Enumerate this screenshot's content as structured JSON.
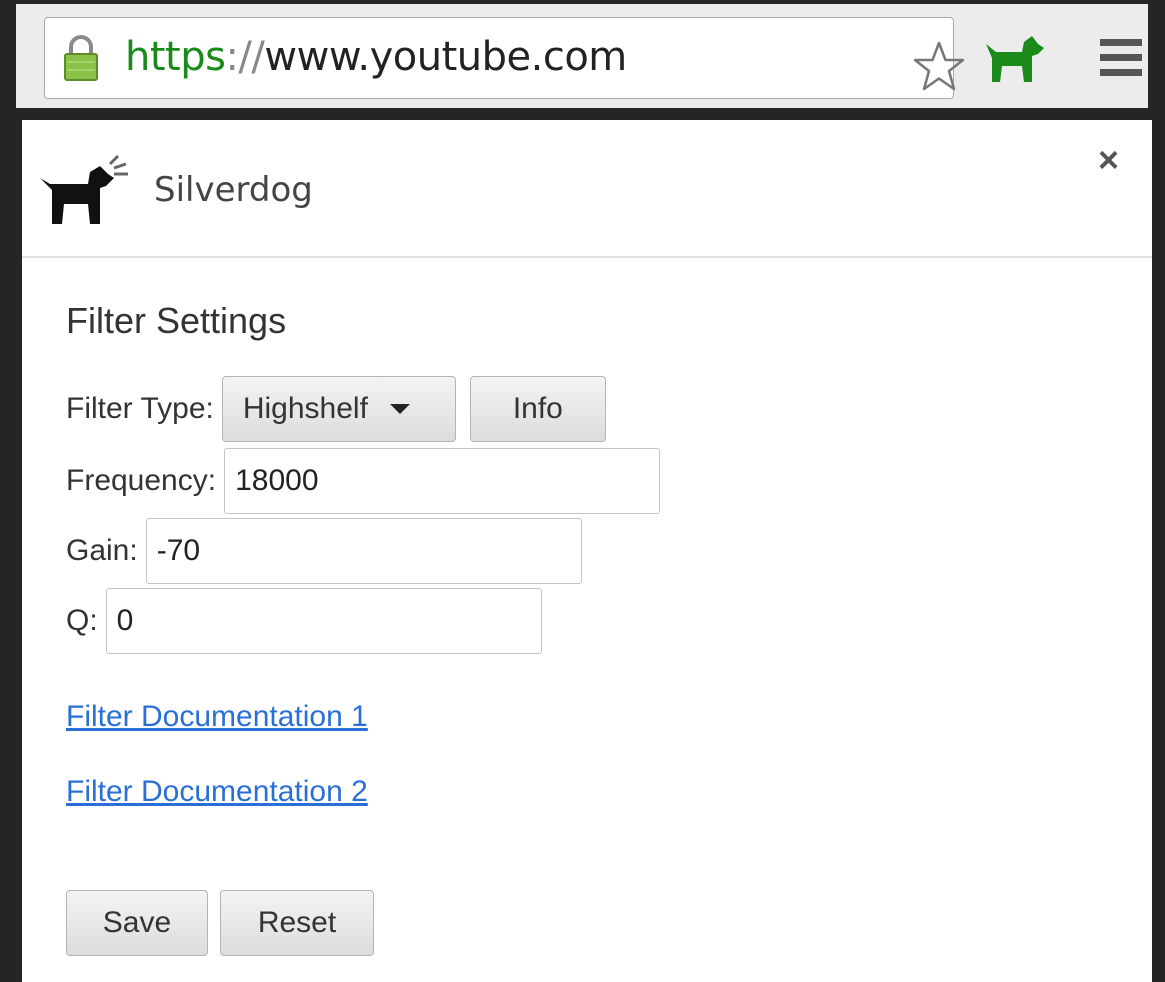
{
  "browser": {
    "url_scheme": "https",
    "url_separator": "://",
    "url_host": "www.youtube.com",
    "icons": [
      "lock-icon",
      "star-icon",
      "dog-extension-icon",
      "menu-icon"
    ],
    "accent": "#1a8a1a"
  },
  "popup": {
    "app_name": "Silverdog",
    "close_label": "×",
    "section_title": "Filter Settings",
    "filter_type": {
      "label": "Filter Type:",
      "selected": "Highshelf",
      "info_button": "Info"
    },
    "frequency": {
      "label": "Frequency:",
      "value": "18000"
    },
    "gain": {
      "label": "Gain:",
      "value": "-70"
    },
    "q": {
      "label": "Q:",
      "value": "0"
    },
    "links": [
      "Filter Documentation 1",
      "Filter Documentation 2"
    ],
    "buttons": {
      "save": "Save",
      "reset": "Reset"
    },
    "link_color": "#2a6fd6"
  }
}
